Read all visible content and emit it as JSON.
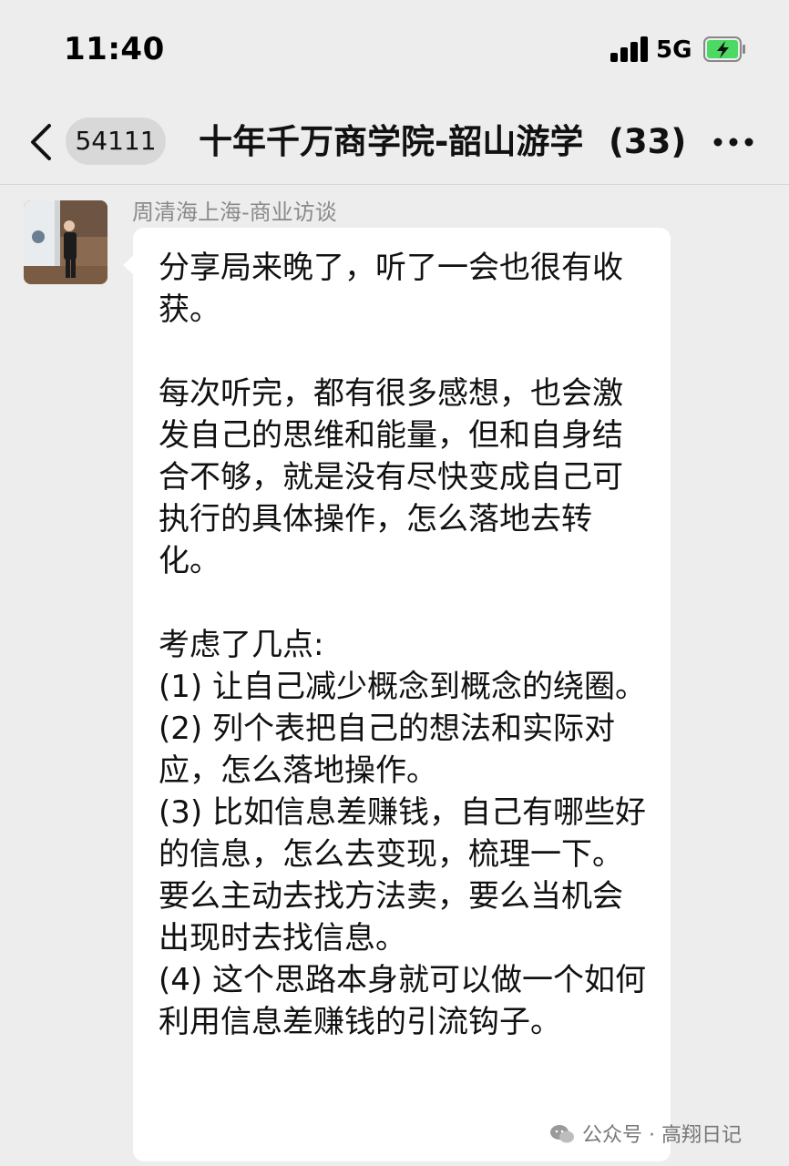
{
  "status_bar": {
    "time": "11:40",
    "network": "5G",
    "battery_charging": true
  },
  "nav": {
    "unread_badge": "54111",
    "chat_title": "十年千万商学院-韶山游学",
    "member_count": "(33)"
  },
  "message": {
    "sender": "周清海上海-商业访谈",
    "text": "分享局来晚了，听了一会也很有收获。\n\n每次听完，都有很多感想，也会激发自己的思维和能量，但和自身结合不够，就是没有尽快变成自己可执行的具体操作，怎么落地去转化。\n\n考虑了几点:\n(1) 让自己减少概念到概念的绕圈。\n(2) 列个表把自己的想法和实际对应，怎么落地操作。\n(3) 比如信息差赚钱，自己有哪些好的信息，怎么去变现，梳理一下。要么主动去找方法卖，要么当机会出现时去找信息。\n(4) 这个思路本身就可以做一个如何利用信息差赚钱的引流钩子。"
  },
  "watermark": {
    "text": "公众号 · 高翔日记"
  },
  "icons": {
    "back": "chevron-left-icon",
    "more": "more-dots-icon",
    "signal": "cellular-signal-icon",
    "battery": "battery-charging-icon",
    "watermark": "wechat-icon"
  },
  "colors": {
    "background": "#ededed",
    "bubble": "#ffffff",
    "battery_fill": "#4cd964",
    "sender_text": "#8a8a8a"
  }
}
